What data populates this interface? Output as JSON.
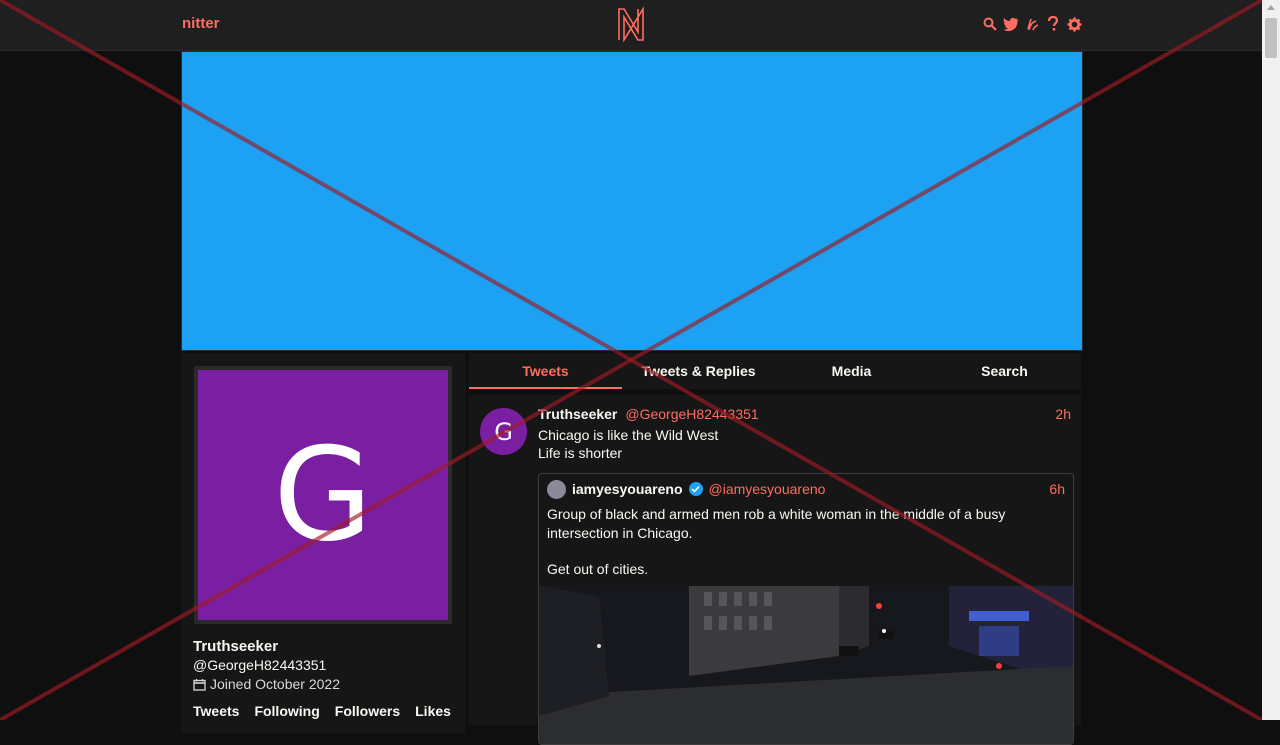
{
  "nav": {
    "brand": "nitter",
    "logo_letter": "N",
    "icons": [
      "search-icon",
      "twitter-icon",
      "rss-icon",
      "help-icon",
      "gear-icon"
    ]
  },
  "colors": {
    "accent": "#ff6c60",
    "banner": "#1da1f2",
    "avatar_bg": "#7b1fa2",
    "bg": "#0f0f0f",
    "panel": "#161616"
  },
  "profile": {
    "avatar_letter": "G",
    "name": "Truthseeker",
    "handle": "@GeorgeH82443351",
    "joined": "Joined October 2022",
    "stats": [
      "Tweets",
      "Following",
      "Followers",
      "Likes"
    ]
  },
  "tabs": [
    {
      "label": "Tweets",
      "active": true
    },
    {
      "label": "Tweets & Replies",
      "active": false
    },
    {
      "label": "Media",
      "active": false
    },
    {
      "label": "Search",
      "active": false
    }
  ],
  "tweet": {
    "avatar_letter": "G",
    "fullname": "Truthseeker",
    "username": "@GeorgeH82443351",
    "date": "2h",
    "line1": "Chicago is like the Wild West",
    "line2": "Life is shorter",
    "quote": {
      "fullname": "iamyesyouareno",
      "username": "@iamyesyouareno",
      "date": "6h",
      "text1": "Group of black and armed men rob a white woman in the middle of a busy intersection in Chicago.",
      "text2": "Get out of cities."
    }
  }
}
